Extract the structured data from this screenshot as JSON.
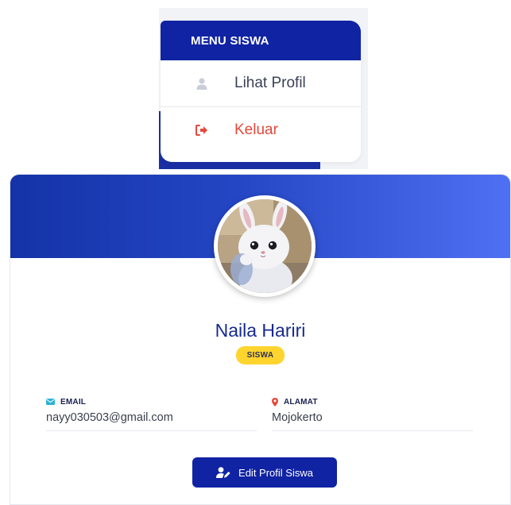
{
  "menu": {
    "header": "MENU SISWA",
    "items": [
      {
        "label": "Lihat Profil",
        "icon": "user-icon",
        "color": "#3b4256"
      },
      {
        "label": "Keluar",
        "icon": "sign-out-icon",
        "color": "#e5483c"
      }
    ]
  },
  "profile": {
    "name": "Naila Hariri",
    "role_badge": "SISWA",
    "avatar_icon": "bunny-avatar",
    "fields": {
      "email": {
        "label": "EMAIL",
        "value": "nayy030503@gmail.com",
        "icon": "envelope-icon",
        "icon_color": "#2bb3d6"
      },
      "alamat": {
        "label": "ALAMAT",
        "value": "Mojokerto",
        "icon": "map-marker-icon",
        "icon_color": "#e5483c"
      }
    },
    "edit_button": {
      "label": "Edit Profil Siswa",
      "icon": "user-edit-icon"
    }
  },
  "colors": {
    "primary": "#0f23a3",
    "name_text": "#162a8e",
    "badge": "#ffd42e",
    "danger": "#e5483c"
  }
}
